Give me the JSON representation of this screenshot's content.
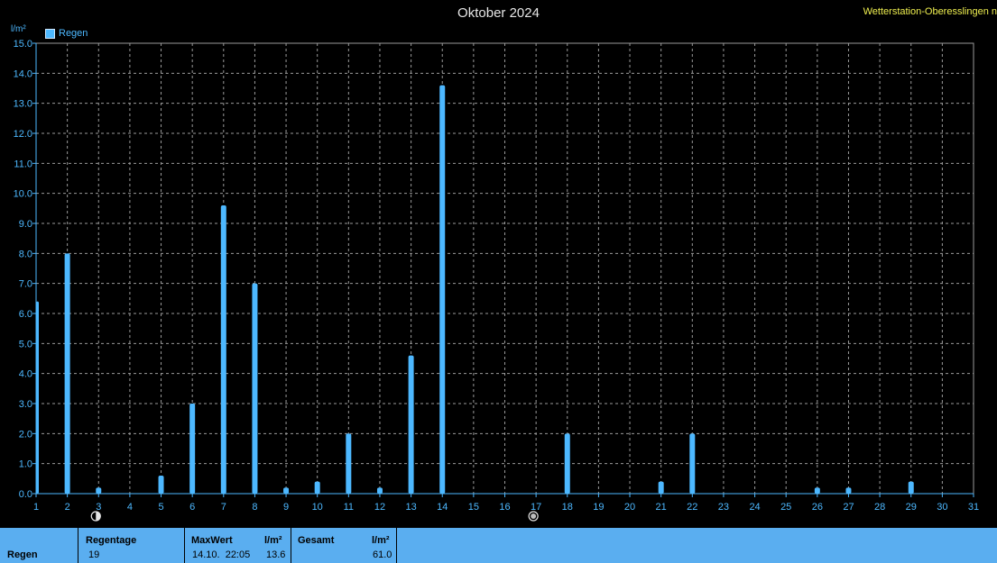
{
  "title": "Oktober 2024",
  "station": "Wetterstation-Oberesslingen n",
  "legend": "Regen",
  "y_unit": "l/m²",
  "colors": {
    "bar": "#4db8ff",
    "axis": "#4db8ff",
    "grid": "#9a9a9a",
    "panel": "#5aaef0",
    "title": "#e6e6e6",
    "station": "#f0f050"
  },
  "moon_icons": [
    {
      "day": 3,
      "icon": "first-quarter-moon-icon"
    },
    {
      "day": 17,
      "icon": "full-moon-icon"
    }
  ],
  "chart_data": {
    "type": "bar",
    "title": "Oktober 2024",
    "ylabel": "l/m²",
    "ylim": [
      0,
      15
    ],
    "yticks": [
      "0.0",
      "1.0",
      "2.0",
      "3.0",
      "4.0",
      "5.0",
      "6.0",
      "7.0",
      "8.0",
      "9.0",
      "10.0",
      "11.0",
      "12.0",
      "13.0",
      "14.0",
      "15.0"
    ],
    "xlim": [
      1,
      31
    ],
    "xticks": [
      "1",
      "2",
      "3",
      "4",
      "5",
      "6",
      "7",
      "8",
      "9",
      "10",
      "11",
      "12",
      "13",
      "14",
      "15",
      "16",
      "17",
      "18",
      "19",
      "20",
      "21",
      "22",
      "23",
      "24",
      "25",
      "26",
      "27",
      "28",
      "29",
      "30",
      "31"
    ],
    "grid": true,
    "legend": "top-left",
    "series": [
      {
        "name": "Regen",
        "x": [
          1,
          2,
          3,
          4,
          5,
          6,
          7,
          8,
          9,
          10,
          11,
          12,
          13,
          14,
          15,
          16,
          17,
          18,
          19,
          20,
          21,
          22,
          23,
          24,
          25,
          26,
          27,
          28,
          29,
          30
        ],
        "values": [
          6.4,
          8.0,
          0.2,
          0.0,
          0.6,
          3.0,
          9.6,
          7.0,
          0.2,
          0.4,
          2.0,
          0.2,
          4.6,
          13.6,
          0.0,
          0.0,
          0.0,
          2.0,
          0.0,
          0.0,
          0.4,
          2.0,
          0.0,
          0.0,
          0.0,
          0.2,
          0.2,
          0.0,
          0.4,
          0.0
        ]
      }
    ]
  },
  "summary": {
    "row_label": "Regen",
    "regentage_label": "Regentage",
    "regentage_value": "19",
    "maxwert_label": "MaxWert",
    "maxwert_unit": "l/m²",
    "maxwert_date": "14.10.  22:05",
    "maxwert_value": "13.6",
    "gesamt_label": "Gesamt",
    "gesamt_unit": "l/m²",
    "gesamt_value": "61.0"
  }
}
